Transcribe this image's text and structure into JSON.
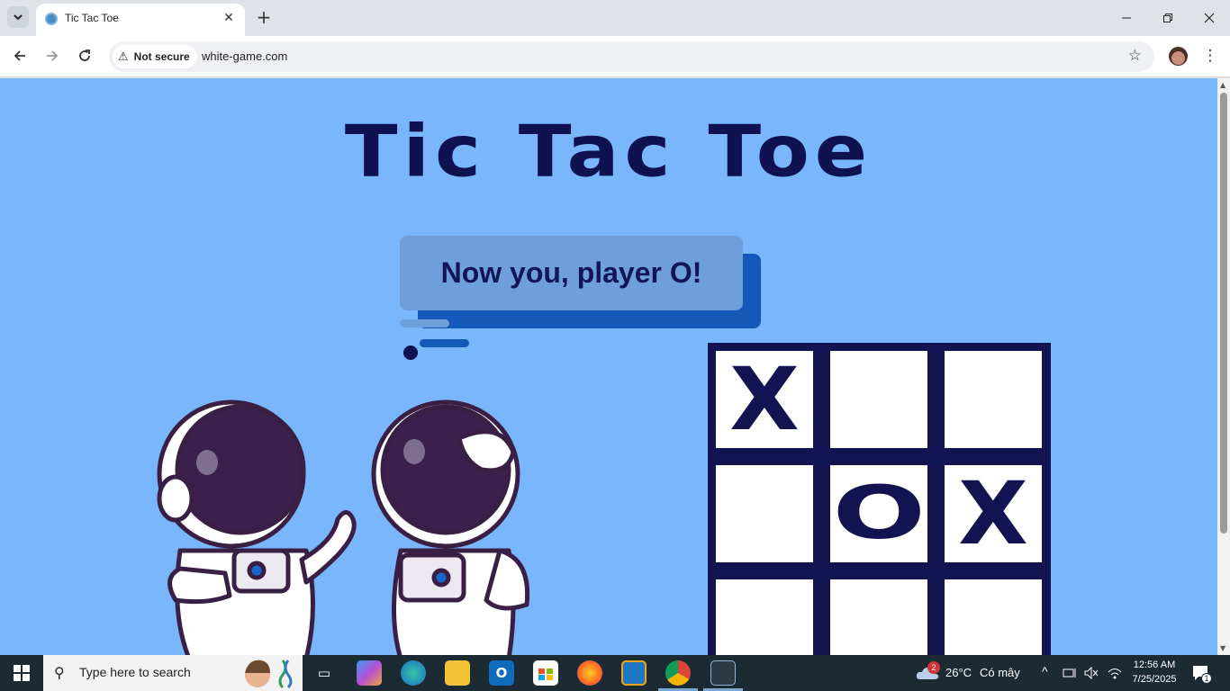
{
  "browser": {
    "tab_title": "Tic Tac Toe",
    "security_label": "Not secure",
    "url": "white-game.com"
  },
  "page": {
    "title": "Tic Tac Toe",
    "status_message": "Now you, player O!",
    "board": [
      [
        "X",
        "",
        ""
      ],
      [
        "",
        "O",
        "X"
      ],
      [
        "",
        "",
        ""
      ]
    ],
    "colors": {
      "background": "#79b6fc",
      "title": "#0f1150",
      "bubble": "#6f9fda",
      "bubble_shadow": "#1559b8",
      "board": "#121452"
    }
  },
  "taskbar": {
    "search_placeholder": "Type here to search",
    "weather_temp": "26°C",
    "weather_desc": "Có mây",
    "weather_badge": "2",
    "time": "12:56 AM",
    "date": "7/25/2025",
    "notification_count": "1",
    "apps": [
      "task-view",
      "copilot",
      "edge",
      "file-explorer",
      "outlook",
      "microsoft-store",
      "firefox",
      "virtualbox",
      "chrome",
      "snipping-tool"
    ]
  }
}
